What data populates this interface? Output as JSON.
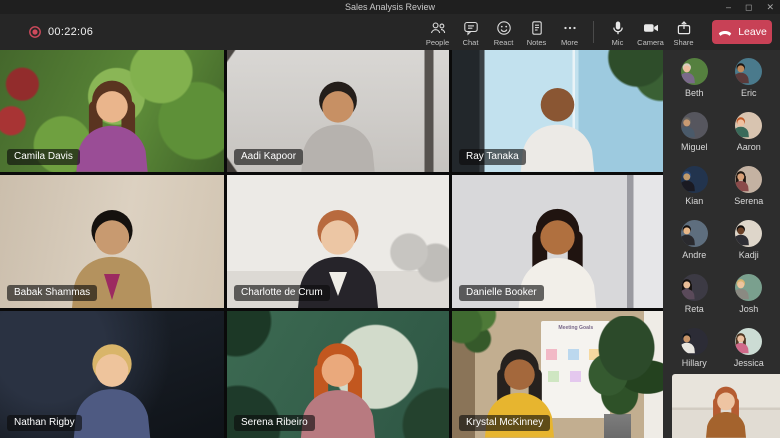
{
  "window": {
    "title": "Sales Analysis Review",
    "controls": {
      "minimize": "–",
      "maximize": "◻",
      "close": "✕"
    }
  },
  "meeting": {
    "timer": "00:22:06"
  },
  "toolbar": {
    "buttons": [
      {
        "label": "People"
      },
      {
        "label": "Chat"
      },
      {
        "label": "React"
      },
      {
        "label": "Notes"
      },
      {
        "label": "More"
      }
    ],
    "device_buttons": [
      {
        "label": "Mic"
      },
      {
        "label": "Camera"
      },
      {
        "label": "Share"
      }
    ],
    "leave_label": "Leave"
  },
  "grid": {
    "tiles": [
      {
        "name": "Camila Davis"
      },
      {
        "name": "Aadi Kapoor"
      },
      {
        "name": "Ray Tanaka"
      },
      {
        "name": "Babak Shammas"
      },
      {
        "name": "Charlotte de Crum"
      },
      {
        "name": "Danielle Booker"
      },
      {
        "name": "Nathan Rigby"
      },
      {
        "name": "Serena Ribeiro"
      },
      {
        "name": "Krystal McKinney",
        "whiteboard_text": "Meeting Goals"
      }
    ]
  },
  "sidebar": {
    "participants": [
      {
        "name": "Beth"
      },
      {
        "name": "Eric"
      },
      {
        "name": "Miguel"
      },
      {
        "name": "Aaron"
      },
      {
        "name": "Kian"
      },
      {
        "name": "Serena"
      },
      {
        "name": "Andre"
      },
      {
        "name": "Kadji"
      },
      {
        "name": "Reta"
      },
      {
        "name": "Josh"
      },
      {
        "name": "Hillary"
      },
      {
        "name": "Jessica"
      }
    ]
  },
  "colors": {
    "leave_red": "#c84156",
    "record_red": "#cf4a5c",
    "topbar_bg": "#262626",
    "sidebar_bg": "#2d2d2d"
  }
}
